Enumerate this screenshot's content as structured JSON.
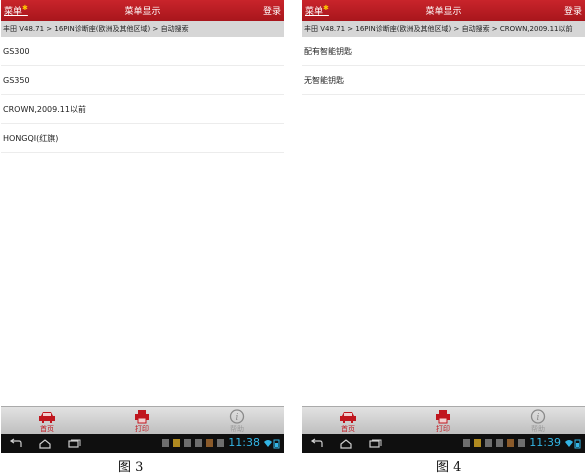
{
  "screens": [
    {
      "header": {
        "menu_label": "菜单",
        "title": "菜单显示",
        "login_label": "登录"
      },
      "breadcrumb": "丰田 V48.71 > 16PIN诊断座(欧洲及其他区域) > 自动搜索",
      "items": [
        "GS300",
        "GS350",
        "CROWN,2009.11以前",
        "HONGQI(红旗)"
      ],
      "tabs": {
        "home": "首页",
        "print": "打印",
        "help": "帮助"
      },
      "status": {
        "time": "11:38"
      },
      "caption": "图 3"
    },
    {
      "header": {
        "menu_label": "菜单",
        "title": "菜单显示",
        "login_label": "登录"
      },
      "breadcrumb": "丰田 V48.71 > 16PIN诊断座(欧洲及其他区域) > 自动搜索 > CROWN,2009.11以前",
      "items": [
        "配有智能钥匙",
        "无智能钥匙"
      ],
      "tabs": {
        "home": "首页",
        "print": "打印",
        "help": "帮助"
      },
      "status": {
        "time": "11:39"
      },
      "caption": "图 4"
    }
  ],
  "colors": {
    "header_red": "#c0161e",
    "clock_blue": "#33b5e5"
  }
}
